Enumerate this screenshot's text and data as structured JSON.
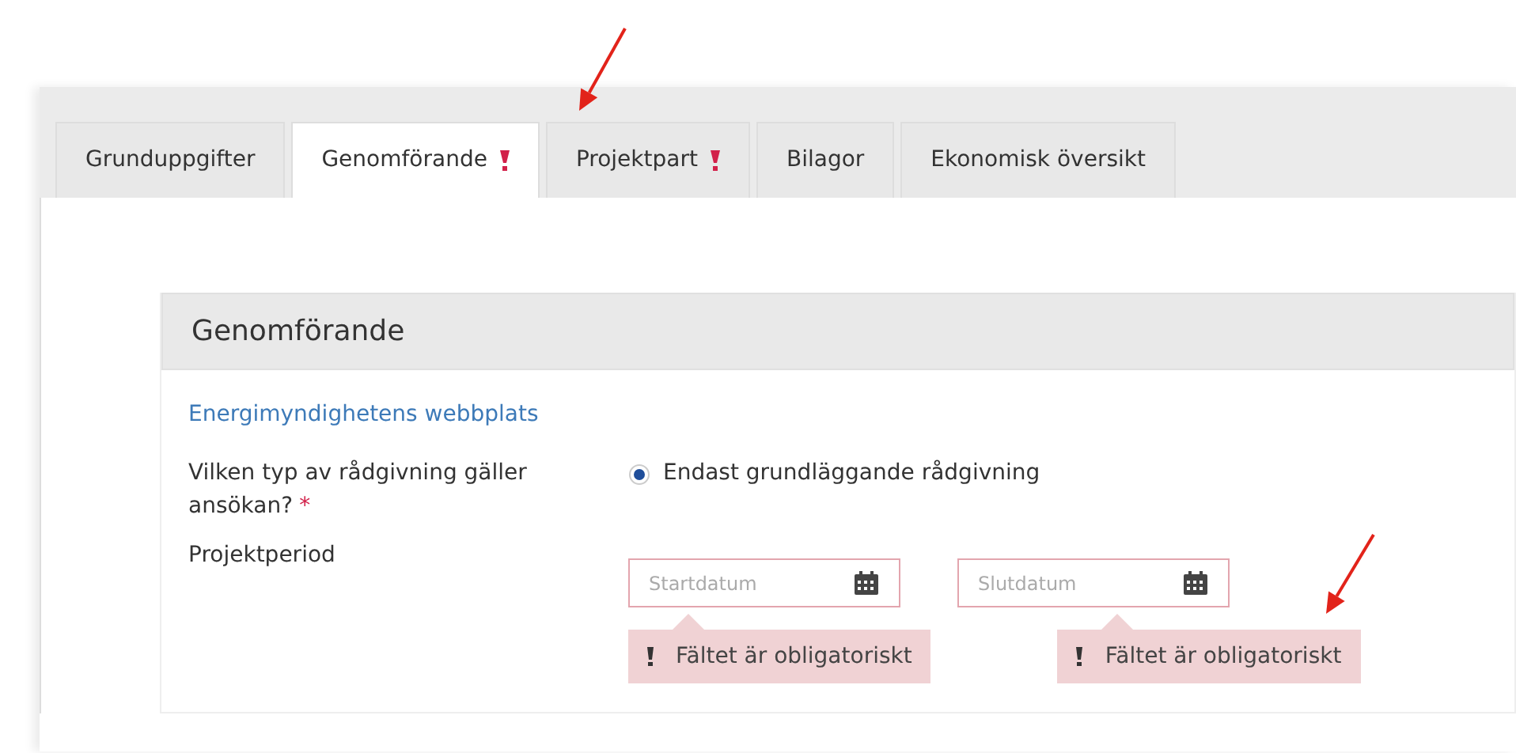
{
  "tabs": [
    {
      "label": "Grunduppgifter",
      "selected": false,
      "error": false
    },
    {
      "label": "Genomförande",
      "selected": true,
      "error": true
    },
    {
      "label": "Projektpart",
      "selected": false,
      "error": true
    },
    {
      "label": "Bilagor",
      "selected": false,
      "error": false
    },
    {
      "label": "Ekonomisk översikt",
      "selected": false,
      "error": false
    }
  ],
  "section": {
    "title": "Genomförande",
    "link": "Energimyndighetens webbplats",
    "question": {
      "label": "Vilken typ av rådgivning gäller ansökan?",
      "required_mark": "*",
      "options": [
        {
          "label": "Endast grundläggande rådgivning",
          "selected": true
        }
      ]
    },
    "period": {
      "label": "Projektperiod",
      "fields": [
        {
          "placeholder": "Startdatum",
          "invalid": true,
          "error": "Fältet är obligatoriskt"
        },
        {
          "placeholder": "Slutdatum",
          "invalid": true,
          "error": "Fältet är obligatoriskt"
        }
      ]
    }
  },
  "annotations": [
    {
      "kind": "arrow"
    },
    {
      "kind": "arrow"
    }
  ]
}
